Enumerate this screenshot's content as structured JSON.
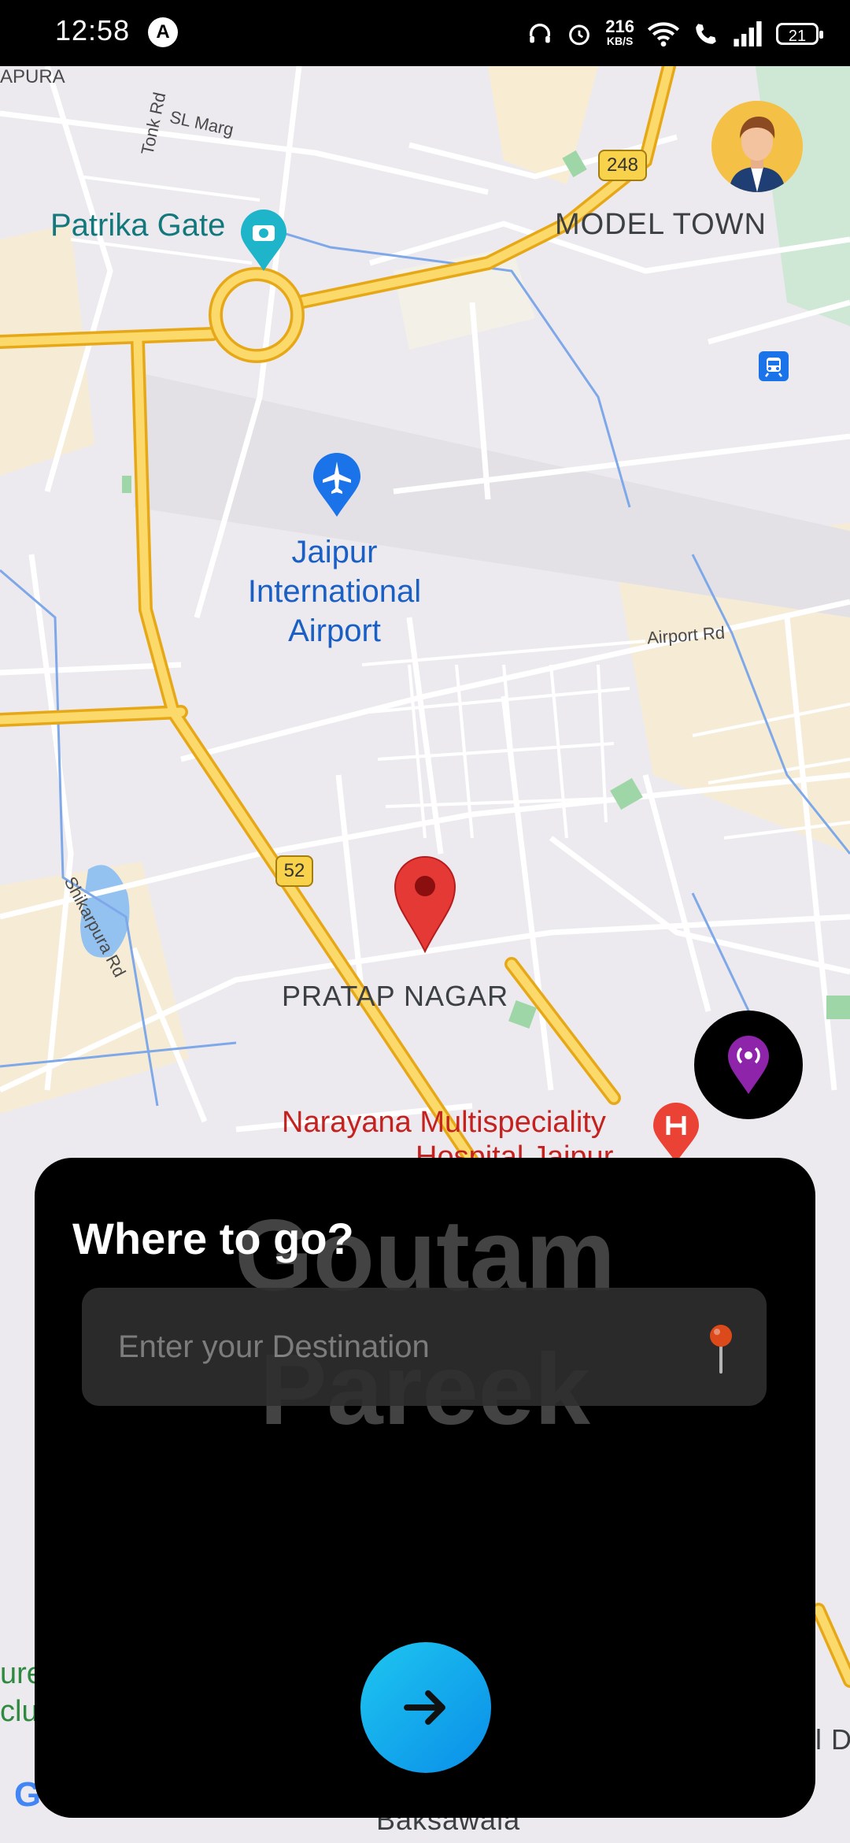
{
  "status_bar": {
    "time": "12:58",
    "nav_badge": "A",
    "speed_value": "216",
    "speed_unit": "KB/S",
    "battery": "21"
  },
  "map": {
    "labels": {
      "apura": "APURA",
      "tonk_rd": "Tonk Rd",
      "sl_marg": "SL Marg",
      "patrika_gate": "Patrika Gate",
      "model_town": "MODEL TOWN",
      "route_248": "248",
      "airport_line1": "Jaipur",
      "airport_line2": "International",
      "airport_line3": "Airport",
      "airport_rd": "Airport Rd",
      "route_52": "52",
      "shikarpura_rd": "Shikarpura Rd",
      "pratap_nagar": "PRATAP NAGAR",
      "narayana": "Narayana Multispeciality",
      "hospital_partial": "Hospital Jaipur",
      "bottom_left_1": "ure",
      "bottom_left_2": "clu",
      "bottom_right": "l D",
      "baksawala": "Baksawala",
      "google": "G"
    }
  },
  "sheet": {
    "title": "Where to go?",
    "watermark_line1": "Goutam",
    "watermark_line2": "Pareek",
    "destination_placeholder": "Enter your Destination",
    "destination_value": ""
  },
  "colors": {
    "accent_purple": "#8e24aa",
    "go_button": "#0a8ee8",
    "pin_red": "#e53935"
  }
}
